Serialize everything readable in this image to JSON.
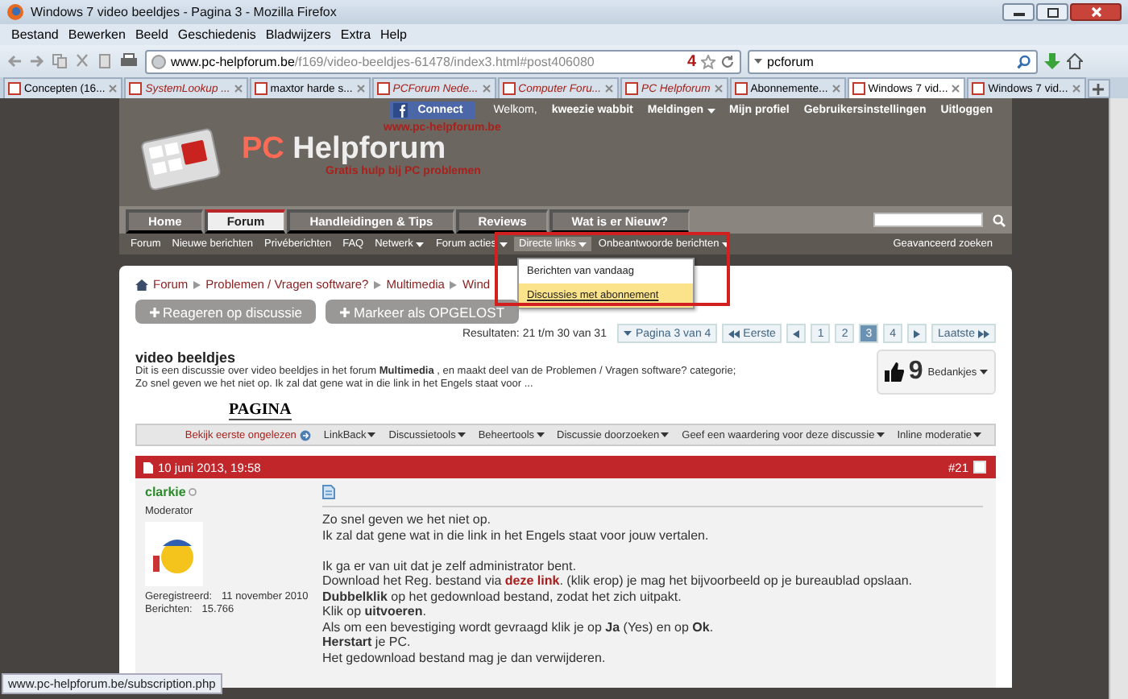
{
  "window": {
    "title": "Windows 7 video beeldjes - Pagina 3 - Mozilla Firefox"
  },
  "menu": [
    "Bestand",
    "Bewerken",
    "Beeld",
    "Geschiedenis",
    "Bladwijzers",
    "Extra",
    "Help"
  ],
  "address": {
    "domain": "www.pc-helpforum.be",
    "path": "/f169/video-beeldjes-61478/index3.html#post406080",
    "counter": "4"
  },
  "search": {
    "value": "pcforum"
  },
  "tabs": [
    {
      "label": "Concepten (16...",
      "selected": false,
      "italic": false
    },
    {
      "label": "SystemLookup ...",
      "selected": false,
      "italic": true
    },
    {
      "label": "maxtor harde s...",
      "selected": false,
      "italic": false
    },
    {
      "label": "PCForum Nede...",
      "selected": false,
      "italic": true
    },
    {
      "label": "Computer Foru...",
      "selected": false,
      "italic": true
    },
    {
      "label": "PC Helpforum",
      "selected": false,
      "italic": true
    },
    {
      "label": "Abonnemente...",
      "selected": false,
      "italic": false
    },
    {
      "label": "Windows 7 vid...",
      "selected": true,
      "italic": false
    },
    {
      "label": "Windows 7 vid...",
      "selected": false,
      "italic": false
    }
  ],
  "site": {
    "connect": "Connect",
    "welcome": "Welkom,",
    "user": "kweezie wabbit",
    "user_links": [
      {
        "label": "Meldingen",
        "dropdown": true
      },
      {
        "label": "Mijn profiel",
        "dropdown": false
      },
      {
        "label": "Gebruikersinstellingen",
        "dropdown": false
      },
      {
        "label": "Uitloggen",
        "dropdown": false
      }
    ],
    "site_url": "www.pc-helpforum.be",
    "logo_pc": "PC",
    "logo_name": "Helpforum",
    "tagline": "Gratis hulp bij PC problemen"
  },
  "nav_tabs": [
    {
      "label": "Home",
      "selected": false
    },
    {
      "label": "Forum",
      "selected": true
    },
    {
      "label": "Handleidingen & Tips",
      "selected": false
    },
    {
      "label": "Reviews",
      "selected": false
    },
    {
      "label": "Wat is er Nieuw?",
      "selected": false
    }
  ],
  "subnav": [
    {
      "label": "Forum",
      "dropdown": false,
      "selected": false
    },
    {
      "label": "Nieuwe berichten",
      "dropdown": false,
      "selected": false
    },
    {
      "label": "Privéberichten",
      "dropdown": false,
      "selected": false
    },
    {
      "label": "FAQ",
      "dropdown": false,
      "selected": false
    },
    {
      "label": "Netwerk",
      "dropdown": true,
      "selected": false
    },
    {
      "label": "Forum acties",
      "dropdown": true,
      "selected": false
    },
    {
      "label": "Directe links",
      "dropdown": true,
      "selected": true,
      "menu": [
        {
          "label": "Berichten van vandaag",
          "selected": false
        },
        {
          "label": "Discussies met abonnement",
          "selected": true
        }
      ]
    },
    {
      "label": "Onbeantwoorde berichten",
      "dropdown": true,
      "selected": false
    }
  ],
  "advanced_search": "Geavanceerd zoeken",
  "breadcrumb": [
    "Forum",
    "Problemen / Vragen software?",
    "Multimedia",
    "Wind"
  ],
  "actions": [
    "Reageren op discussie",
    "Markeer als OPGELOST"
  ],
  "results": "Resultaten: 21 t/m 30 van 31",
  "pagination": {
    "page_menu": "Pagina 3 van 4",
    "first": "Eerste",
    "pages": [
      {
        "label": "1",
        "selected": false
      },
      {
        "label": "2",
        "selected": false
      },
      {
        "label": "3",
        "selected": true
      },
      {
        "label": "4",
        "selected": false
      }
    ],
    "last": "Laatste"
  },
  "thread": {
    "title": "video beeldjes",
    "description": "Dit is een discussie over video beeldjes in het forum **Multimedia** , en maakt deel van de Problemen / Vragen software? categorie;",
    "excerpt": "Zo snel geven we het niet op. Ik zal dat gene wat in die link in het Engels staat voor ...",
    "thanks_count": "9",
    "thanks_label": "Bedankjes"
  },
  "banner": "PAGINA",
  "thread_tools": {
    "first_unread": "Bekijk eerste ongelezen",
    "menus": [
      "LinkBack",
      "Discussietools",
      "Beheertools",
      "Discussie doorzoeken",
      "Geef een waardering voor deze discussie",
      "Inline moderatie"
    ]
  },
  "post": {
    "date": "10 juni 2013, 19:58",
    "number": "#21",
    "user": "clarkie",
    "online": false,
    "role": "Moderator",
    "stats": [
      {
        "label": "Geregistreerd:",
        "value": "11 november 2010"
      },
      {
        "label": "Berichten:",
        "value": "15.766"
      }
    ],
    "paragraphs": [
      [
        [
          {
            "kind": "plain",
            "text": "Zo snel geven we het niet op."
          }
        ],
        [
          {
            "kind": "plain",
            "text": "Ik zal dat gene wat in die link in het Engels staat voor jouw vertalen."
          }
        ]
      ],
      [
        [
          {
            "kind": "plain",
            "text": "Ik ga er van uit dat je zelf administrator bent."
          }
        ],
        [
          {
            "kind": "plain",
            "text": "Download het Reg. bestand via "
          },
          {
            "kind": "link",
            "text": "deze link"
          },
          {
            "kind": "plain",
            "text": ". (klik erop) je mag het bijvoorbeeld op je bureaublad opslaan."
          }
        ],
        [
          {
            "kind": "bold",
            "text": "Dubbelklik"
          },
          {
            "kind": "plain",
            "text": " op het gedownload bestand, zodat het zich uitpakt."
          }
        ],
        [
          {
            "kind": "plain",
            "text": "Klik op "
          },
          {
            "kind": "bold",
            "text": "uitvoeren"
          },
          {
            "kind": "plain",
            "text": "."
          }
        ],
        [
          {
            "kind": "plain",
            "text": "Als om een bevestiging wordt gevraagd klik je op "
          },
          {
            "kind": "bold",
            "text": "Ja"
          },
          {
            "kind": "plain",
            "text": " (Yes) en op "
          },
          {
            "kind": "bold",
            "text": "Ok"
          },
          {
            "kind": "plain",
            "text": "."
          }
        ],
        [
          {
            "kind": "bold",
            "text": "Herstart"
          },
          {
            "kind": "plain",
            "text": " je PC."
          }
        ],
        [
          {
            "kind": "plain",
            "text": "Het gedownload bestand mag je dan verwijderen."
          }
        ]
      ]
    ]
  },
  "status_url": "www.pc-helpforum.be/subscription.php"
}
